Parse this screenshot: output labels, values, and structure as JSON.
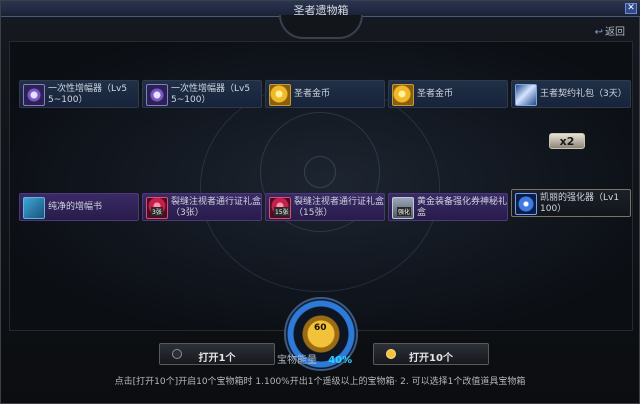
{
  "window": {
    "title": "圣者遗物箱",
    "back_label": "返回"
  },
  "items": [
    {
      "label": "一次性增幅器（Lv5 5~100）",
      "icon": "amplifier-icon",
      "style": "blue"
    },
    {
      "label": "一次性增幅器（Lv5 5~100）",
      "icon": "amplifier-icon",
      "style": "blue"
    },
    {
      "label": "圣者金币",
      "icon": "gold-coin-icon",
      "style": "blue"
    },
    {
      "label": "圣者金币",
      "icon": "gold-coin-icon",
      "style": "blue"
    },
    {
      "label": "王者契约礼包（3天）",
      "icon": "gift-pack-icon",
      "style": "blue"
    },
    {
      "label": "纯净的增幅书",
      "icon": "amplify-book-icon",
      "style": "purple"
    },
    {
      "label": "裂缝注视者通行证礼盒（3张）",
      "icon": "ticket-icon",
      "style": "purple",
      "badge": "3张"
    },
    {
      "label": "裂缝注视者通行证礼盒（15张）",
      "icon": "ticket-icon",
      "style": "purple",
      "badge": "15张"
    },
    {
      "label": "黄金装备强化券神秘礼盒",
      "icon": "mystery-box-icon",
      "style": "purple",
      "badge": "强化"
    },
    {
      "label": "凯丽的强化器（Lv1 100）",
      "icon": "enhancer-icon",
      "style": "dark",
      "multiplier": "x2"
    }
  ],
  "buttons": {
    "open_one": "打开1个",
    "open_ten": "打开10个"
  },
  "energy": {
    "label": "宝物能量",
    "value": "40%"
  },
  "medal": {
    "value": "60"
  },
  "hint": "点击[打开10个]开启10个宝物箱时 1.100%开出1个遥级以上的宝物箱· 2. 可以选择1个改值道具宝物箱"
}
